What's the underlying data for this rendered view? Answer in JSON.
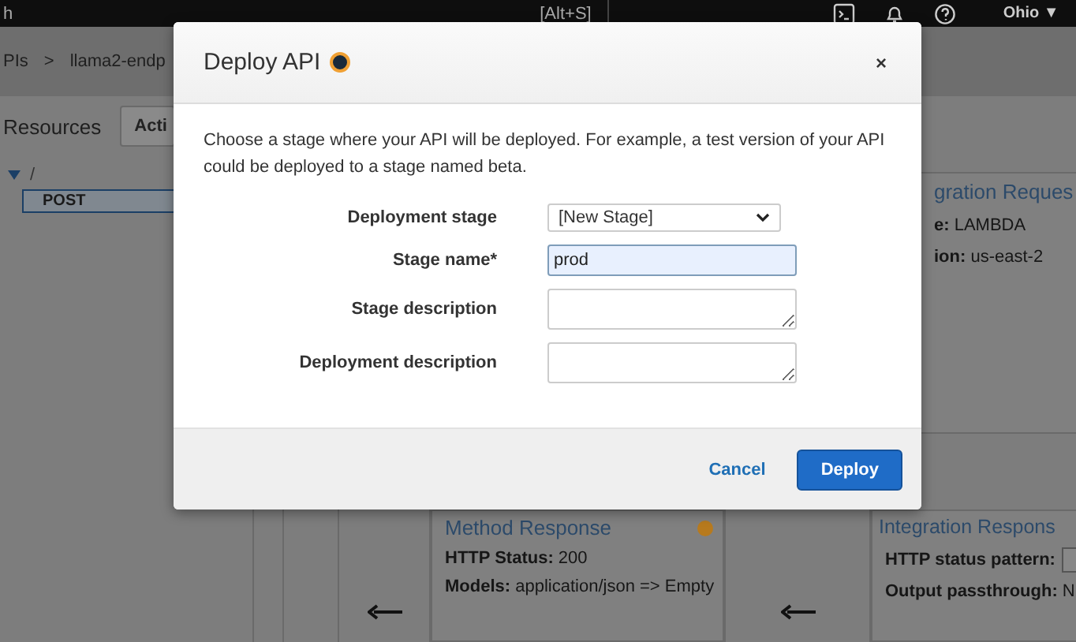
{
  "top_bar": {
    "search_text": "h",
    "search_shortcut": "[Alt+S]",
    "region": "Ohio ▼"
  },
  "breadcrumb": [
    "PIs",
    ">",
    "llama2-endp"
  ],
  "resources": {
    "title": "Resources",
    "actions_button": "Acti",
    "tree": [
      {
        "label": "/",
        "expanded": true,
        "children": [
          {
            "label": "POST",
            "selected": true
          }
        ]
      }
    ]
  },
  "integration_request": {
    "title": "gration Reques",
    "lines": [
      {
        "label": "e:",
        "value": "LAMBDA"
      },
      {
        "label": "ion:",
        "value": "us-east-2"
      }
    ]
  },
  "method_response": {
    "title": "Method Response",
    "lines": [
      {
        "label": "HTTP Status:",
        "value": "200"
      },
      {
        "label": "Models:",
        "value": "application/json => Empty"
      }
    ]
  },
  "integration_response": {
    "title": "Integration Respons",
    "lines": [
      {
        "label": "HTTP status pattern:",
        "kind": "field"
      },
      {
        "label": "Output passthrough:",
        "kind": "text",
        "value": "N"
      }
    ]
  },
  "dialog": {
    "title": "Deploy API",
    "close": "×",
    "description": "Choose a stage where your API will be deployed. For example, a test version of your API could be deployed to a stage named beta.",
    "fields": [
      {
        "kind": "select",
        "label": "Deployment stage",
        "value": "[New Stage]",
        "focused": false
      },
      {
        "kind": "input",
        "label": "Stage name*",
        "value": "prod",
        "focused": true
      },
      {
        "kind": "textarea",
        "label": "Stage description",
        "focused": false
      },
      {
        "kind": "textarea",
        "label": "Deployment description",
        "focused": false
      }
    ],
    "buttons": [
      {
        "kind": "link",
        "label": "Cancel"
      },
      {
        "kind": "primary",
        "label": "Deploy"
      }
    ]
  }
}
